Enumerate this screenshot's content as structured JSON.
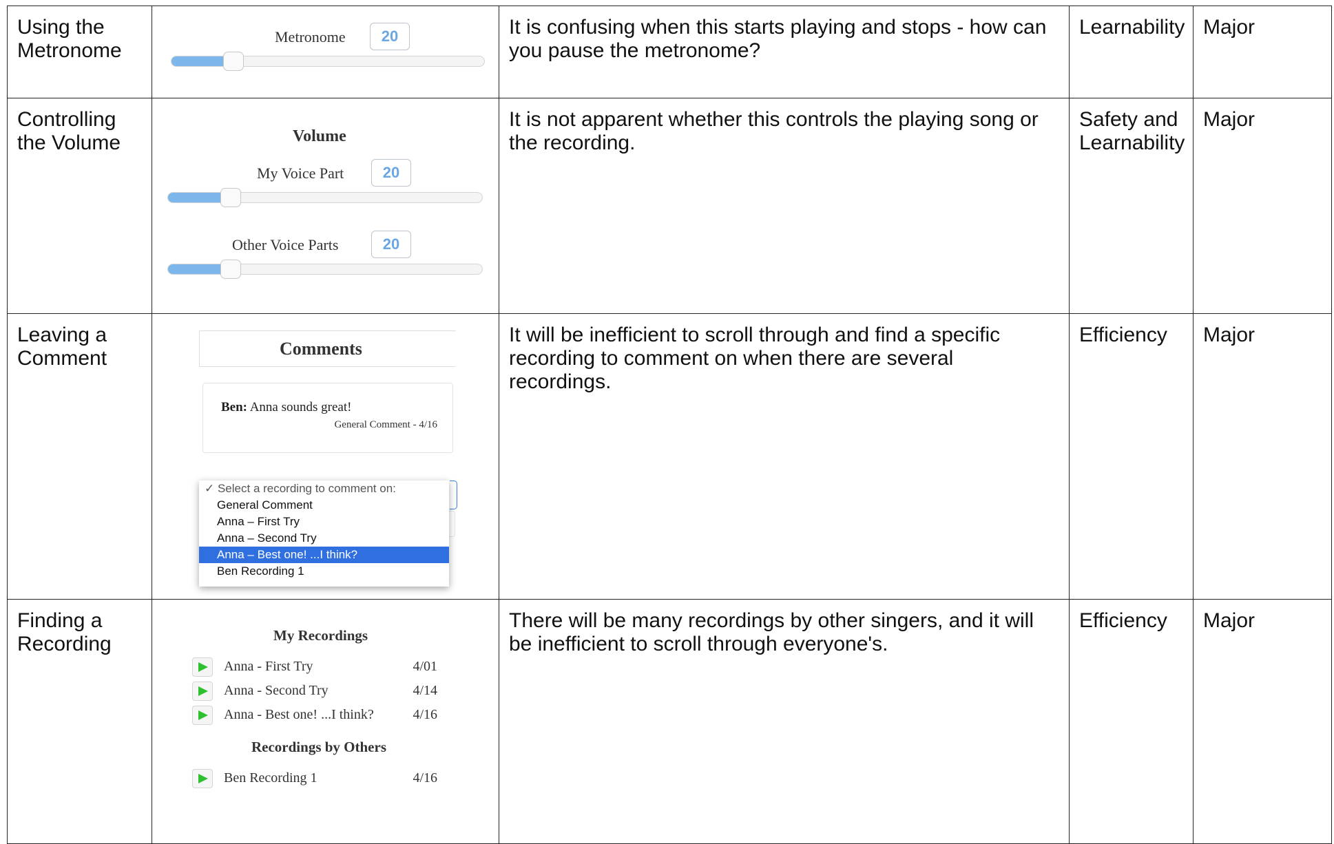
{
  "rows": [
    {
      "task": "Using the Metronome",
      "issue": "It is confusing when this starts playing and stops - how can you pause the metronome?",
      "heuristic": "Learnability",
      "severity": "Major",
      "widget": {
        "label": "Metronome",
        "value": "20",
        "level_percent": 20
      }
    },
    {
      "task": "Controlling the Volume",
      "issue": "It is not apparent whether this controls the playing song or the recording.",
      "heuristic": "Safety and Learnability",
      "severity": "Major",
      "widget": {
        "heading": "Volume",
        "sliders": [
          {
            "label": "My Voice Part",
            "value": "20",
            "level_percent": 20
          },
          {
            "label": "Other Voice Parts",
            "value": "20",
            "level_percent": 20
          }
        ]
      }
    },
    {
      "task": "Leaving a Comment",
      "issue": "It will be inefficient to scroll through and find a specific recording to comment on when there are several recordings.",
      "heuristic": "Efficiency",
      "severity": "Major",
      "widget": {
        "heading": "Comments",
        "comment_author": "Ben:",
        "comment_text": "Anna sounds great!",
        "comment_meta": "General Comment - 4/16",
        "dropdown_header": "✓ Select a recording to comment on:",
        "options": [
          "General Comment",
          "Anna – First Try",
          "Anna – Second Try",
          "Anna – Best one! ...I think?",
          "Ben Recording 1"
        ],
        "selected_index": 3
      }
    },
    {
      "task": "Finding a Recording",
      "issue": "There will be many recordings by other singers, and it will be inefficient to scroll through everyone's.",
      "heuristic": "Efficiency",
      "severity": "Major",
      "widget": {
        "my_heading": "My Recordings",
        "my_recordings": [
          {
            "name": "Anna - First Try",
            "date": "4/01"
          },
          {
            "name": "Anna - Second Try",
            "date": "4/14"
          },
          {
            "name": "Anna - Best one! ...I think?",
            "date": "4/16"
          }
        ],
        "others_heading": "Recordings by Others",
        "other_recordings": [
          {
            "name": "Ben Recording 1",
            "date": "4/16"
          }
        ]
      }
    }
  ],
  "colors": {
    "slider_fill": "#7cb6ea",
    "number": "#6aa6e3",
    "selected_option": "#2f6fe0",
    "play_icon": "#2ec02e"
  }
}
